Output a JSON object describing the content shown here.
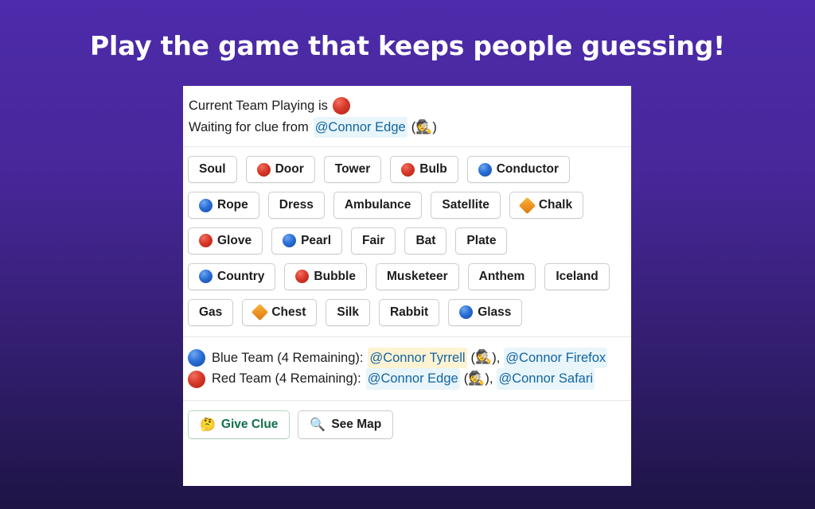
{
  "slide": {
    "title": "Play the game that keeps people guessing!",
    "background_top_color": "#4d2bab",
    "background_bottom_color": "#1e1445"
  },
  "card": {
    "status": {
      "line1_prefix": "Current Team Playing is",
      "line1_marker": "red-circle-icon",
      "line2_prefix": "Waiting for clue from",
      "line2_mention": "@Connor Edge",
      "line2_open_paren": "(",
      "line2_emoji": "detective-emoji",
      "line2_close_paren": ")"
    },
    "grid": {
      "rows": [
        [
          {
            "word": "Soul",
            "marker": "none"
          },
          {
            "word": "Door",
            "marker": "red"
          },
          {
            "word": "Tower",
            "marker": "none"
          },
          {
            "word": "Bulb",
            "marker": "red"
          },
          {
            "word": "Conductor",
            "marker": "blue"
          }
        ],
        [
          {
            "word": "Rope",
            "marker": "blue"
          },
          {
            "word": "Dress",
            "marker": "none"
          },
          {
            "word": "Ambulance",
            "marker": "none"
          },
          {
            "word": "Satellite",
            "marker": "none"
          },
          {
            "word": "Chalk",
            "marker": "orange-diamond"
          }
        ],
        [
          {
            "word": "Glove",
            "marker": "red"
          },
          {
            "word": "Pearl",
            "marker": "blue"
          },
          {
            "word": "Fair",
            "marker": "none"
          },
          {
            "word": "Bat",
            "marker": "none"
          },
          {
            "word": "Plate",
            "marker": "none"
          }
        ],
        [
          {
            "word": "Country",
            "marker": "blue"
          },
          {
            "word": "Bubble",
            "marker": "red"
          },
          {
            "word": "Musketeer",
            "marker": "none"
          },
          {
            "word": "Anthem",
            "marker": "none"
          },
          {
            "word": "Iceland",
            "marker": "none"
          }
        ],
        [
          {
            "word": "Gas",
            "marker": "none"
          },
          {
            "word": "Chest",
            "marker": "orange-diamond"
          },
          {
            "word": "Silk",
            "marker": "none"
          },
          {
            "word": "Rabbit",
            "marker": "none"
          },
          {
            "word": "Glass",
            "marker": "blue"
          }
        ]
      ]
    },
    "teams": {
      "blue": {
        "marker": "blue-circle-icon",
        "label": "Blue Team (4 Remaining):",
        "spymaster": "@Connor Tyrrell",
        "spymaster_emoji": "detective-emoji",
        "separator": ",",
        "operative": "@Connor Firefox"
      },
      "red": {
        "marker": "red-circle-icon",
        "label": "Red Team (4 Remaining):",
        "spymaster": "@Connor Edge",
        "spymaster_emoji": "detective-emoji",
        "separator": ",",
        "operative": "@Connor Safari"
      }
    },
    "footer": {
      "give_clue_label": "Give Clue",
      "give_clue_emoji": "thinking-face-emoji",
      "see_map_label": "See Map",
      "see_map_emoji": "magnifying-glass-icon"
    }
  }
}
